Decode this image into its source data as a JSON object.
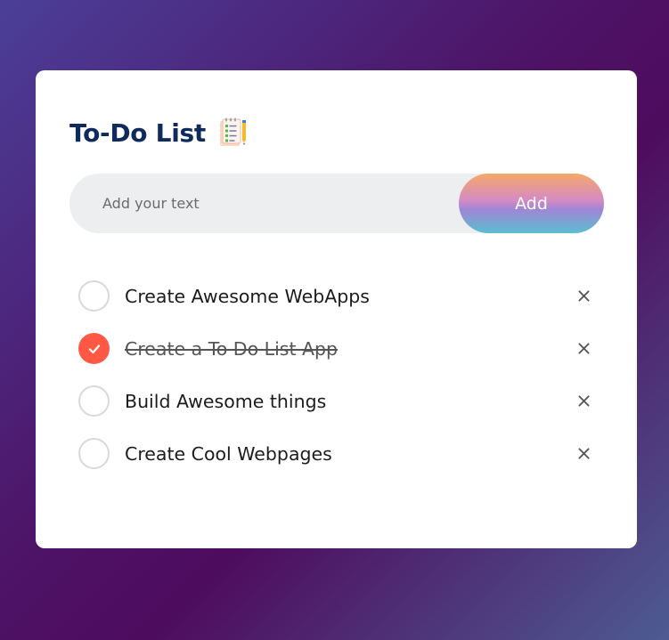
{
  "header": {
    "title": "To-Do List"
  },
  "input": {
    "placeholder": "Add your text",
    "value": ""
  },
  "add_button": {
    "label": "Add"
  },
  "tasks": [
    {
      "text": "Create Awesome WebApps",
      "checked": false
    },
    {
      "text": "Create a To Do List App",
      "checked": true
    },
    {
      "text": "Build Awesome things",
      "checked": false
    },
    {
      "text": "Create Cool Webpages",
      "checked": false
    }
  ],
  "icons": {
    "title_icon": "notepad-with-pencil-icon",
    "check_icon": "checkmark-icon",
    "remove_icon": "close-icon"
  },
  "colors": {
    "title": "#0f2a5c",
    "checked": "#ff5945",
    "unchecked_border": "#d9d9d9",
    "input_bg": "#edeef0",
    "card_bg": "#ffffff"
  }
}
